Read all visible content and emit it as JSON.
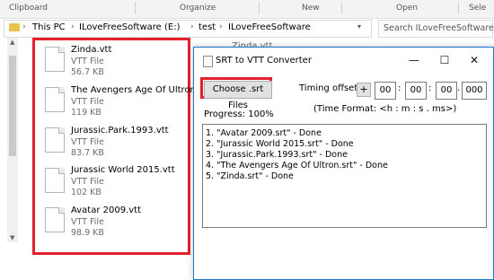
{
  "ribbon": {
    "sections": [
      "Clipboard",
      "Organize",
      "New",
      "Open",
      "Sele"
    ]
  },
  "address": {
    "crumbs": [
      "This PC",
      "ILoveFreeSoftware (E:)",
      "test",
      "ILoveFreeSoftware"
    ],
    "search_placeholder": "Search ILoveFreeSoftware"
  },
  "background_item": "Zinda.vtt",
  "files": [
    {
      "name": "Zinda.vtt",
      "type": "VTT File",
      "size": "56.7 KB"
    },
    {
      "name": "The Avengers Age Of Ultron.vtt",
      "type": "VTT File",
      "size": "119 KB"
    },
    {
      "name": "Jurassic.Park.1993.vtt",
      "type": "VTT File",
      "size": "83.7 KB"
    },
    {
      "name": "Jurassic World 2015.vtt",
      "type": "VTT File",
      "size": "102 KB"
    },
    {
      "name": "Avatar 2009.vtt",
      "type": "VTT File",
      "size": "98.9 KB"
    }
  ],
  "dialog": {
    "title": "SRT to VTT Converter",
    "choose_label": "Choose .srt Files",
    "timing_label": "Timing offset:",
    "sign": "+",
    "offset": [
      "00",
      "00",
      "00",
      "000"
    ],
    "separators": [
      ":",
      ":",
      "."
    ],
    "format_hint": "(Time Format: <h : m : s . ms>)",
    "progress": "Progress: 100%",
    "log": [
      "1. \"Avatar 2009.srt\" - Done",
      "2. \"Jurassic World 2015.srt\" - Done",
      "3. \"Jurassic.Park.1993.srt\" - Done",
      "4. \"The Avengers Age Of Ultron.srt\" - Done",
      "5. \"Zinda.srt\" - Done"
    ]
  },
  "colors": {
    "highlight": "#e3202c",
    "window_border": "#1e78d0",
    "folder": "#e8c24a"
  }
}
